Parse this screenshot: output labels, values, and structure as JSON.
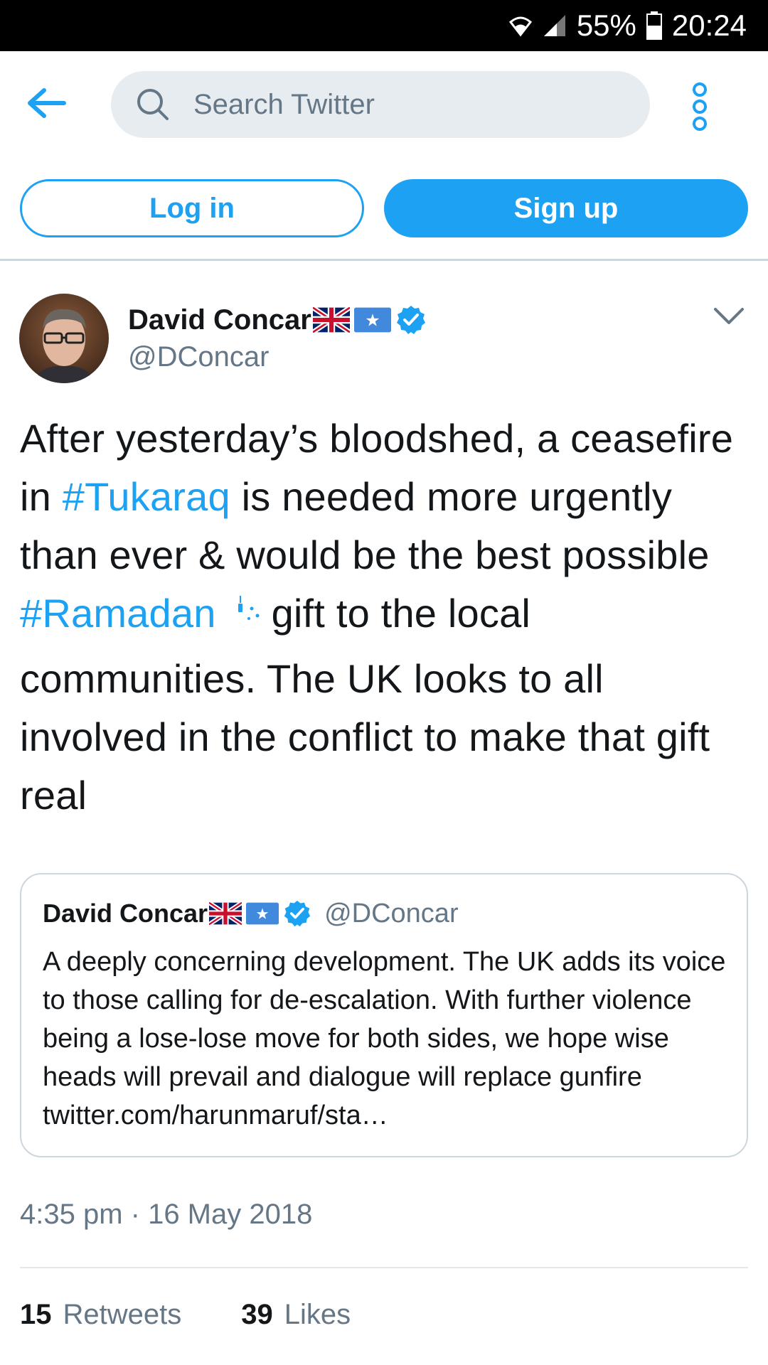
{
  "status_bar": {
    "battery": "55%",
    "time": "20:24"
  },
  "header": {
    "search_placeholder": "Search Twitter"
  },
  "auth": {
    "login_label": "Log in",
    "signup_label": "Sign up"
  },
  "tweet": {
    "author_name": "David Concar",
    "handle": "@DConcar",
    "text_parts": {
      "p1": "After yesterday’s bloodshed, a ceasefire in ",
      "hashtag1": "#Tukaraq",
      "p2": " is needed more urgently than ever & would be the best possible ",
      "hashtag2": "#Ramadan",
      "p3": "gift to the local communities. The UK looks to all involved in the conflict to make that gift real"
    },
    "timestamp": "4:35 pm · 16 May 2018",
    "retweets_count": "15",
    "retweets_label": "Retweets",
    "likes_count": "39",
    "likes_label": "Likes"
  },
  "quoted_tweet": {
    "author_name": "David Concar",
    "handle": "@DConcar",
    "text": "A deeply concerning development. The UK adds its voice to those calling for de-escalation. With further violence being a lose-lose move for both sides, we hope wise heads will prevail and dialogue will replace gunfire twitter.com/harunmaruf/sta…"
  },
  "colors": {
    "accent": "#1da1f2",
    "muted": "#657786",
    "text": "#14171a",
    "search_bg": "#e6ecf0",
    "border": "#ccd6dd"
  },
  "icons": [
    "wifi-icon",
    "signal-icon",
    "battery-icon",
    "back-arrow-icon",
    "search-icon",
    "more-vertical-icon",
    "uk-flag-icon",
    "somalia-flag-icon",
    "verified-badge-icon",
    "chevron-down-icon",
    "ramadan-moon-icon"
  ]
}
